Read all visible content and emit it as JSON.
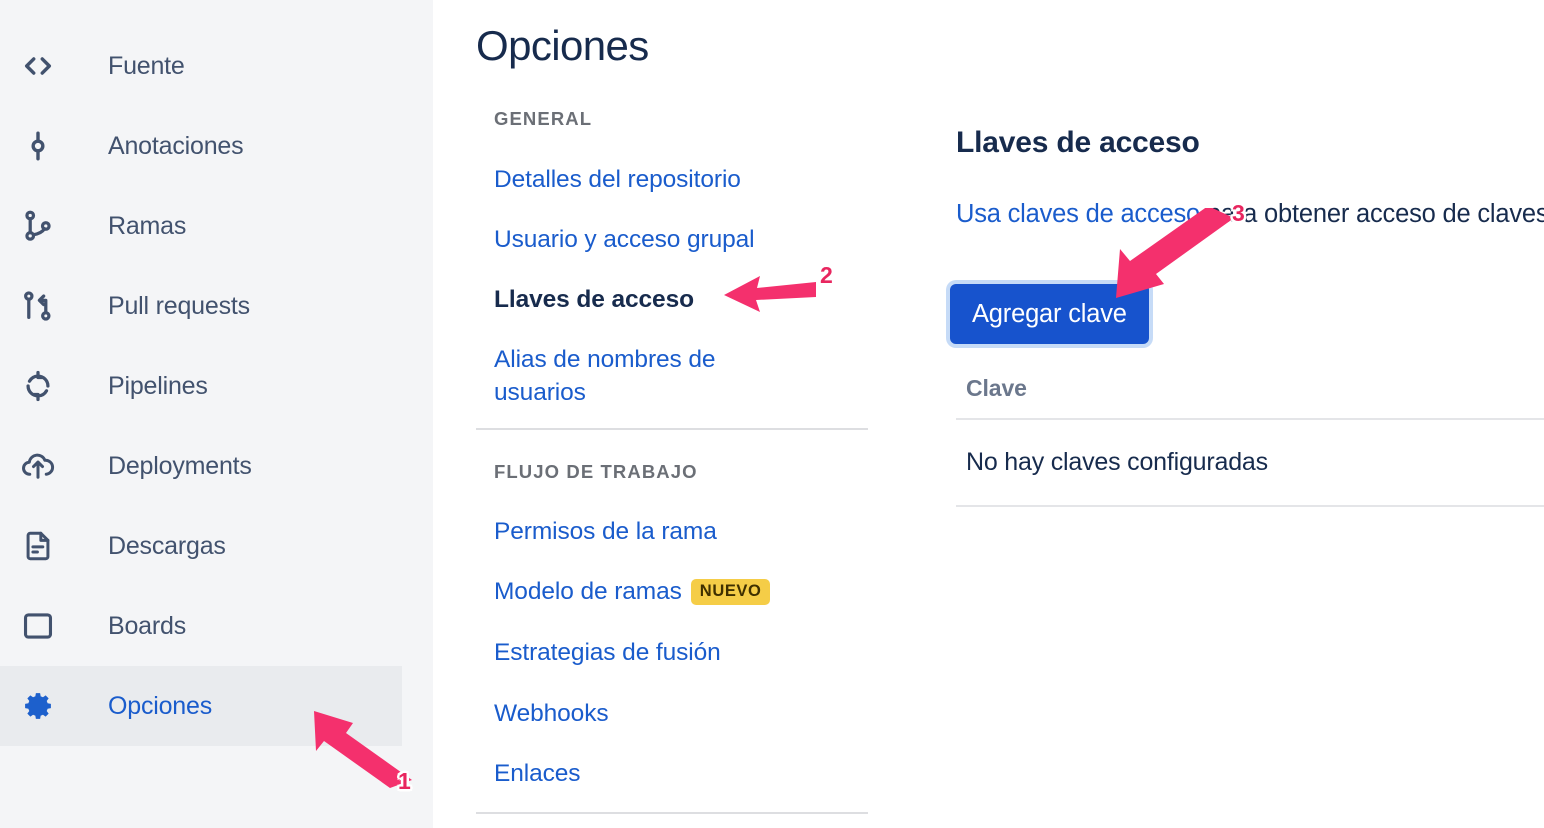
{
  "sidebar": {
    "items": [
      {
        "label": "Fuente",
        "icon": "code-brackets-icon",
        "selected": false
      },
      {
        "label": "Anotaciones",
        "icon": "commit-icon",
        "selected": false
      },
      {
        "label": "Ramas",
        "icon": "branch-icon",
        "selected": false
      },
      {
        "label": "Pull requests",
        "icon": "pull-request-icon",
        "selected": false
      },
      {
        "label": "Pipelines",
        "icon": "pipeline-icon",
        "selected": false
      },
      {
        "label": "Deployments",
        "icon": "cloud-upload-icon",
        "selected": false
      },
      {
        "label": "Descargas",
        "icon": "document-icon",
        "selected": false
      },
      {
        "label": "Boards",
        "icon": "board-icon",
        "selected": false
      },
      {
        "label": "Opciones",
        "icon": "gear-icon",
        "selected": true
      }
    ]
  },
  "options": {
    "title": "Opciones",
    "groups": [
      {
        "heading": "GENERAL",
        "links": [
          {
            "label": "Detalles del repositorio",
            "current": false,
            "badge": ""
          },
          {
            "label": "Usuario y acceso grupal",
            "current": false,
            "badge": ""
          },
          {
            "label": "Llaves de acceso",
            "current": true,
            "badge": ""
          },
          {
            "label": "Alias de nombres de usuarios",
            "current": false,
            "badge": ""
          }
        ]
      },
      {
        "heading": "FLUJO DE TRABAJO",
        "links": [
          {
            "label": "Permisos de la rama",
            "current": false,
            "badge": ""
          },
          {
            "label": "Modelo de ramas",
            "current": false,
            "badge": "NUEVO"
          },
          {
            "label": "Estrategias de fusión",
            "current": false,
            "badge": ""
          },
          {
            "label": "Webhooks",
            "current": false,
            "badge": ""
          },
          {
            "label": "Enlaces",
            "current": false,
            "badge": ""
          }
        ]
      }
    ]
  },
  "detail": {
    "title": "Llaves de acceso",
    "description_link": "Usa claves de acceso",
    "description_rest": " para obtener acceso de claves SSH.",
    "add_key_label": "Agregar clave",
    "table": {
      "columns": [
        "Clave"
      ],
      "empty_message": "No hay claves configuradas"
    }
  },
  "annotations": [
    {
      "number": "1",
      "target": "sidebar-item-opciones"
    },
    {
      "number": "2",
      "target": "option-link-llaves-de-acceso"
    },
    {
      "number": "3",
      "target": "add-key-button"
    }
  ],
  "colors": {
    "link": "#1a5ccc",
    "text": "#172b4d",
    "muted": "#6b778c",
    "sidebar_bg": "#f4f5f7",
    "selected_bg": "#e9ebee",
    "button_bg": "#1753cd",
    "badge_bg": "#f5cd47",
    "annotation": "#e8265f"
  }
}
